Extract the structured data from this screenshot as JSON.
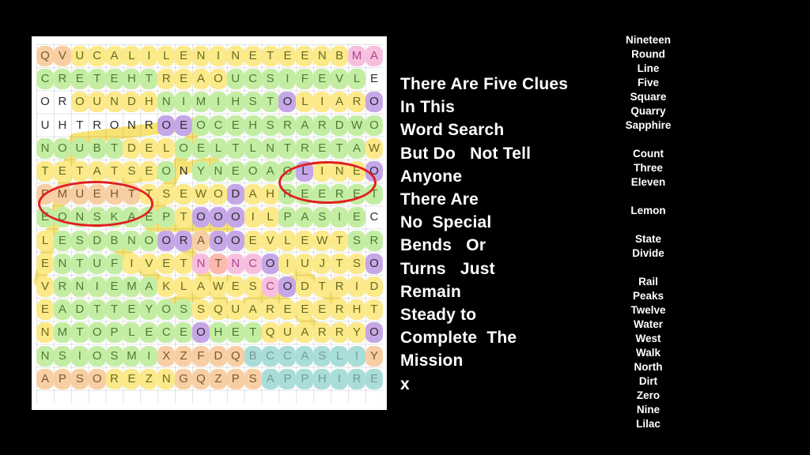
{
  "background_color": "#000000",
  "puzzle": {
    "panel_background": "#ffffff",
    "rows": 15,
    "cols": 20,
    "grid": [
      "QVUCALILENINETEENBMA",
      "CRETEHTREAOUCSIFEVLE",
      "OROUNDHNIMIHSTOLIARO",
      "UHTRONROEOCEHSRARDWO",
      "NOUBTDELOELTLNTRETAW",
      "TETATSEONYNEOAOLINEO",
      "PMUEHTTSEWODAHREERET",
      "EONSKAEPTOOOILPASIEC",
      "LESDBNOORAOOEVLEWTSR",
      "ENTUFIVETNTNCOIUJTSO",
      "VRNIEMAKLAWESCODTRID",
      "EADTTEYOSSQUAREEERHT",
      "NMTOPLECEOHETQUARRYO",
      "NSIOSMIXZFDQBCCASLIY",
      "APSOREZNGQZPSAPPHIRE"
    ],
    "highlight_colors": {
      "yellow": "#fbe98a",
      "green": "#c4eda4",
      "orange": "#f8cfa4",
      "purple": "#c5a7e8",
      "pink": "#f7bfdd",
      "salmon": "#fbb9b0",
      "teal": "#a9ddd9",
      "mint": "#a9e6c7",
      "cyan": "#9de8ef"
    },
    "annotations": [
      {
        "name": "red-circle-theump",
        "circled_text": "PMUEHT",
        "color": "#e02020"
      },
      {
        "name": "red-circle-line",
        "circled_text": "LINE",
        "color": "#e02020"
      }
    ]
  },
  "message": {
    "lines": [
      "There Are Five Clues",
      "In This",
      "Word Search",
      "But Do   Not Tell",
      "Anyone",
      "There Are",
      "No  Special",
      "Bends   Or",
      "Turns   Just",
      "Remain",
      "Steady to",
      "Complete  The",
      "Mission",
      "x"
    ],
    "text_color": "#ffffff"
  },
  "wordlist": {
    "text_color": "#ffffff",
    "groups": [
      [
        "Nineteen",
        "Round",
        "Line",
        "Five",
        "Square",
        "Quarry",
        "Sapphire"
      ],
      [
        "Count",
        "Three",
        "Eleven"
      ],
      [
        "Lemon"
      ],
      [
        "State",
        "Divide"
      ],
      [
        "Rail",
        "Peaks",
        "Twelve",
        "Water",
        "West",
        "Walk",
        "North",
        "Dirt",
        "Zero",
        "Nine",
        "Lilac"
      ]
    ]
  },
  "cell_styles": {
    "note": "per-cell highlight + letter color codes, row-major; h=highlight key, c=letter color key",
    "rows": [
      "ooyyyyyyyyyyyyyyyyPP",
      "gggggggyyyygggggggg g",
      "nnyyyyygggggggpyyyyp",
      "nnnnnnnppggggggggggg",
      "gggggyyygggggggggggy",
      "yyyyyyygnggggggpyyyp",
      "ooooooyyyyypyygggggg",
      "ggggggggypppyyggggg g",
      "yggggggppoppyyyyyygg",
      "yggggyyyykskkpyyyyyp",
      "yggggggyyyyyykpyyyyy",
      "yggggggggyyyyyyyyyyy",
      "yggggggggpgggyyyyyyp",
      "gggggggooooottttttto",
      "ooooyyyyooooottttttt"
    ]
  }
}
